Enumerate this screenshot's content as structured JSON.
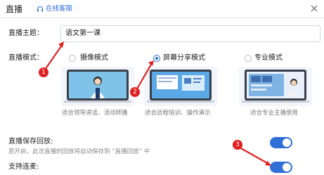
{
  "window": {
    "title": "直播",
    "support_link": "在线客服"
  },
  "form": {
    "topic_label": "直播主题：",
    "topic_value": "语文第一课",
    "mode_label": "直播模式："
  },
  "modes": [
    {
      "label": "摄像模式",
      "desc": "适合领导讲话、活动转播",
      "selected": false
    },
    {
      "label": "屏幕分享模式",
      "desc": "适合远程培训、操作演示",
      "selected": true
    },
    {
      "label": "专业模式",
      "desc": "适合专业主播使用",
      "selected": false
    }
  ],
  "settings": {
    "save_title": "直播保存回放:",
    "save_desc": "若开启，此次直播的回放将自动保存到 “直播回放” 中",
    "save_on": true,
    "linkmic_title": "支持连麦:",
    "linkmic_on": true
  },
  "callouts": [
    "1",
    "2",
    "3"
  ],
  "colors": {
    "accent": "#2f6fd6",
    "callout": "#e02020"
  }
}
